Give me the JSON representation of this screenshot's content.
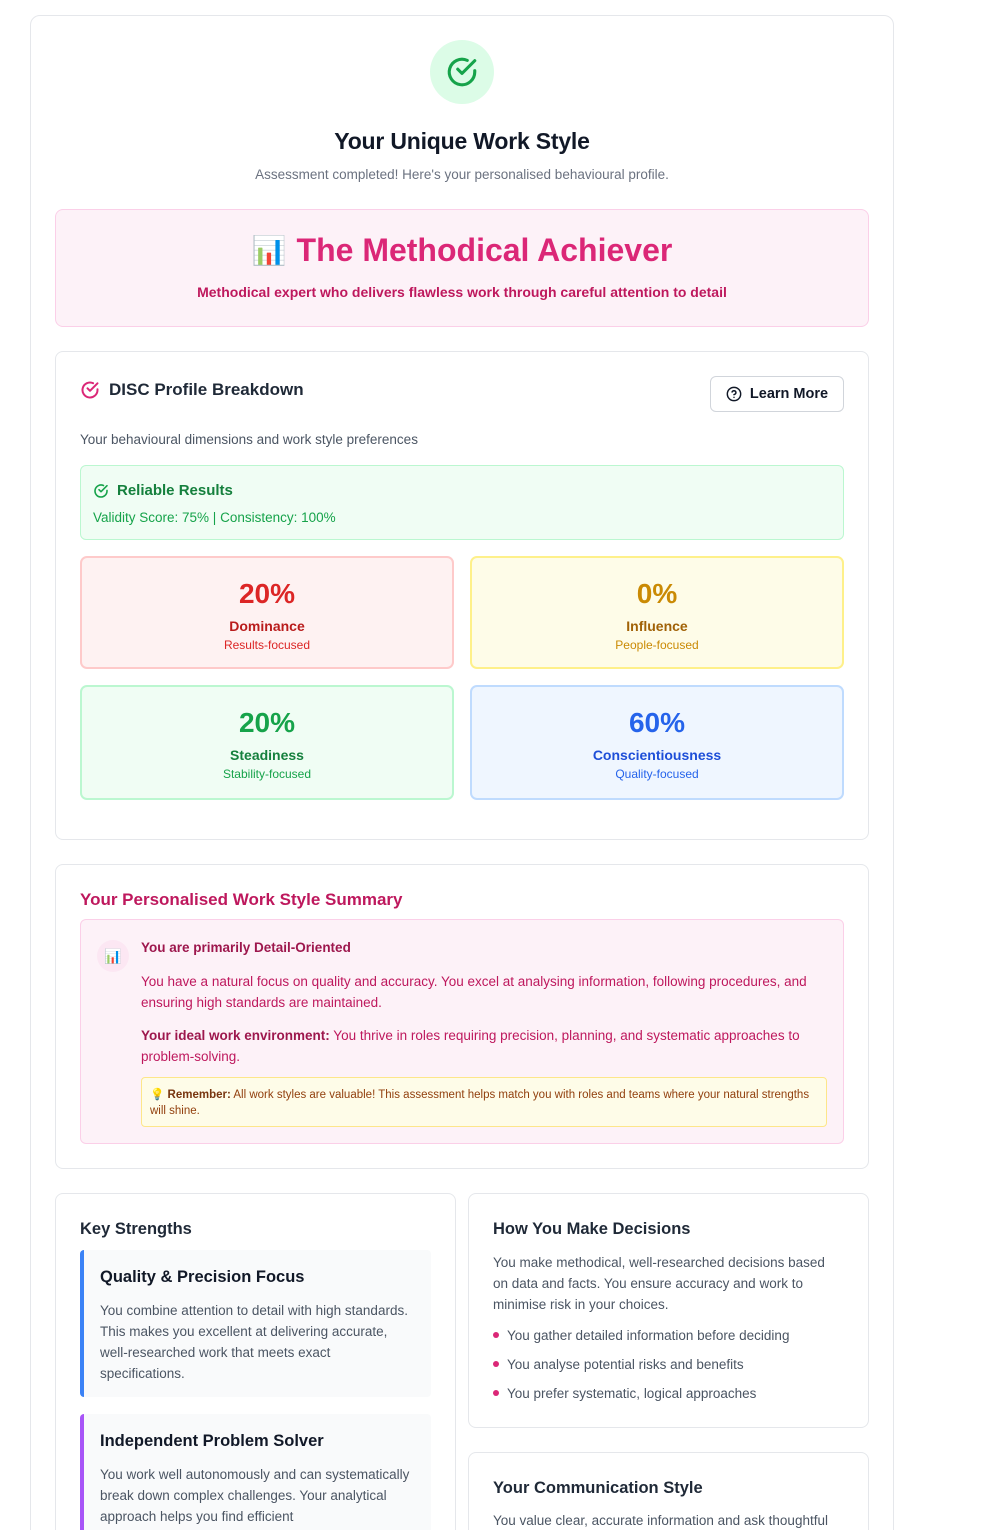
{
  "header": {
    "title": "Your Unique Work Style",
    "subtitle": "Assessment completed! Here's your personalised behavioural profile."
  },
  "archetype": {
    "emoji": "📊",
    "title": "The Methodical Achiever",
    "description": "Methodical expert who delivers flawless work through careful attention to detail"
  },
  "disc": {
    "title": "DISC Profile Breakdown",
    "learn_more_label": "Learn More",
    "description": "Your behavioural dimensions and work style preferences",
    "reliability": {
      "title": "Reliable Results",
      "score_text": "Validity Score: 75% | Consistency: 100%"
    },
    "dimensions": [
      {
        "percent": "20%",
        "name": "Dominance",
        "focus": "Results-focused"
      },
      {
        "percent": "0%",
        "name": "Influence",
        "focus": "People-focused"
      },
      {
        "percent": "20%",
        "name": "Steadiness",
        "focus": "Stability-focused"
      },
      {
        "percent": "60%",
        "name": "Conscientiousness",
        "focus": "Quality-focused"
      }
    ]
  },
  "summary": {
    "title": "Your Personalised Work Style Summary",
    "icon": "📊",
    "heading": "You are primarily Detail-Oriented",
    "paragraph": "You have a natural focus on quality and accuracy. You excel at analysing information, following procedures, and ensuring high standards are maintained.",
    "environment_label": "Your ideal work environment:",
    "environment_text": " You thrive in roles requiring precision, planning, and systematic approaches to problem-solving.",
    "remember_icon": "💡",
    "remember_label": "Remember:",
    "remember_text": " All work styles are valuable! This assessment helps match you with roles and teams where your natural strengths will shine."
  },
  "strengths": {
    "title": "Key Strengths",
    "items": [
      {
        "title": "Quality & Precision Focus",
        "text": "You combine attention to detail with high standards. This makes you excellent at delivering accurate, well-researched work that meets exact specifications."
      },
      {
        "title": "Independent Problem Solver",
        "text": "You work well autonomously and can systematically break down complex challenges. Your analytical approach helps you find efficient"
      }
    ]
  },
  "decisions": {
    "title": "How You Make Decisions",
    "text": "You make methodical, well-researched decisions based on data and facts. You ensure accuracy and work to minimise risk in your choices.",
    "bullets": [
      "You gather detailed information before deciding",
      "You analyse potential risks and benefits",
      "You prefer systematic, logical approaches"
    ]
  },
  "communication": {
    "title": "Your Communication Style",
    "text": "You value clear, accurate information and ask thoughtful"
  },
  "colors": {
    "accent": "#db2777",
    "success": "#16a34a",
    "dominance": "#dc2626",
    "influence": "#ca8a04",
    "steadiness": "#16a34a",
    "conscientiousness": "#2563eb"
  }
}
